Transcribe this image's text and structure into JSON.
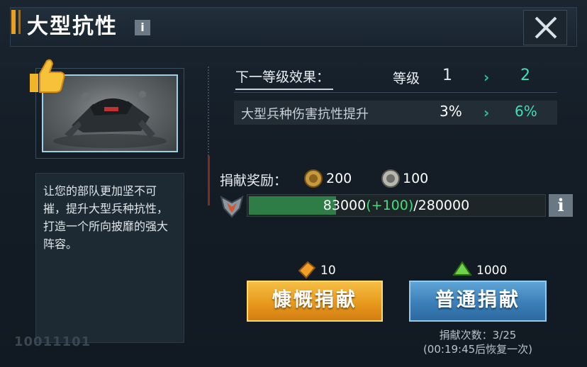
{
  "header": {
    "title": "大型抗性",
    "info_icon": "info-icon",
    "close_icon": "close-icon"
  },
  "left": {
    "image_alt": "mech-illustration",
    "badge_icon": "thumbs-up-icon",
    "description": "让您的部队更加坚不可摧，提升大型兵种抗性，打造一个所向披靡的强大阵容。",
    "watermark": "10011101"
  },
  "effect": {
    "next_level_label": "下一等级效果：",
    "level_label": "等级",
    "level_from": "1",
    "level_to": "2",
    "arrow": "›",
    "stat_label": "大型兵种伤害抗性提升",
    "stat_from": "3%",
    "stat_to": "6%"
  },
  "reward": {
    "label": "捐献奖励：",
    "coin1_icon": "gold-coin-icon",
    "coin1_value": "200",
    "coin2_icon": "silver-coin-icon",
    "coin2_value": "100"
  },
  "progress": {
    "rank_icon": "rank-badge-icon",
    "current": "83000",
    "bonus": "(+100)",
    "total": "/280000",
    "fraction": 0.2964,
    "info_icon": "info-icon"
  },
  "donate": {
    "cost1_icon": "orange-crystal-icon",
    "cost1_value": "10",
    "cost2_icon": "green-crystal-icon",
    "cost2_value": "1000",
    "generous_label": "慷慨捐献",
    "normal_label": "普通捐献",
    "count_text": "捐献次数：3/25",
    "recover_text": "(00:19:45后恢复一次)"
  },
  "colors": {
    "accent_green": "#3ee0b4",
    "progress_fill": "#2e7d46",
    "bonus_green": "#3fe07a",
    "generous_orange": "#e89a1e",
    "normal_blue": "#3c7fb8"
  }
}
